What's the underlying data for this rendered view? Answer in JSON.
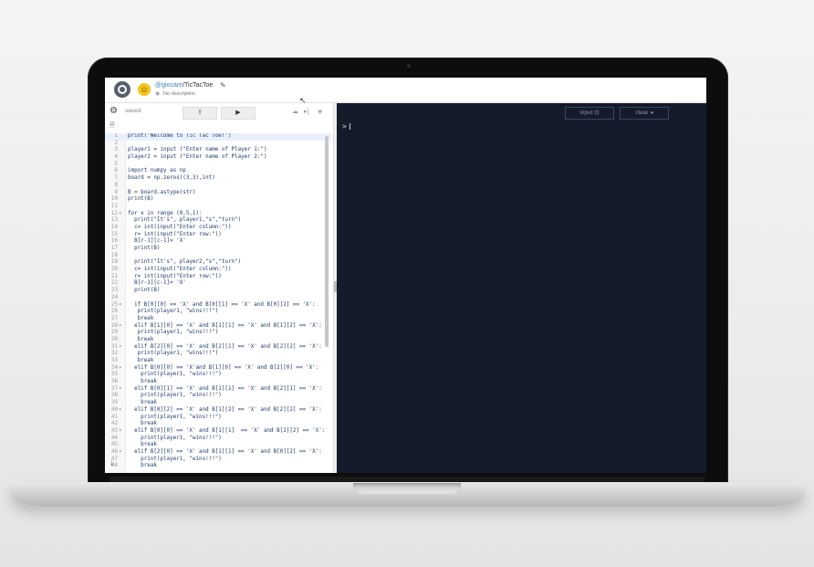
{
  "header": {
    "repo_user": "@giocare",
    "repo_sep": "/",
    "repo_name": "TicTacToe",
    "description": "No description"
  },
  "toolbar": {
    "saved_label": "saved",
    "share_icon": "share-icon",
    "run_icon": "play-icon"
  },
  "console": {
    "input_label": "input",
    "clear_label": "clear",
    "prompt": ">"
  },
  "editor": {
    "lines": [
      {
        "num": "1",
        "fold": "",
        "text": "print('Welcome to Tic Tac Toe!')"
      },
      {
        "num": "2",
        "fold": "",
        "text": ""
      },
      {
        "num": "3",
        "fold": "",
        "text": "player1 = input (\"Enter name of Player 1:\")"
      },
      {
        "num": "4",
        "fold": "",
        "text": "player2 = input (\"Enter name of Player 2:\")"
      },
      {
        "num": "5",
        "fold": "",
        "text": ""
      },
      {
        "num": "6",
        "fold": "",
        "text": "import numpy as np"
      },
      {
        "num": "7",
        "fold": "",
        "text": "board = np.zeros((3,3),int)"
      },
      {
        "num": "8",
        "fold": "",
        "text": ""
      },
      {
        "num": "9",
        "fold": "",
        "text": "B = board.astype(str)"
      },
      {
        "num": "10",
        "fold": "",
        "text": "print(B)"
      },
      {
        "num": "11",
        "fold": "",
        "text": ""
      },
      {
        "num": "12",
        "fold": "▾",
        "text": "for x in range (0,5,1):"
      },
      {
        "num": "13",
        "fold": "",
        "text": "  print(\"It's\", player1,\"s\",\"turn\")"
      },
      {
        "num": "14",
        "fold": "",
        "text": "  c= int(input(\"Enter column:\"))"
      },
      {
        "num": "15",
        "fold": "",
        "text": "  r= int(input(\"Enter row:\"))"
      },
      {
        "num": "16",
        "fold": "",
        "text": "  B[r-1][c-1]= 'X'"
      },
      {
        "num": "17",
        "fold": "",
        "text": "  print(B)"
      },
      {
        "num": "18",
        "fold": "",
        "text": ""
      },
      {
        "num": "19",
        "fold": "",
        "text": "  print(\"It's\", player2,\"s\",\"turn\")"
      },
      {
        "num": "20",
        "fold": "",
        "text": "  c= int(input(\"Enter column:\"))"
      },
      {
        "num": "21",
        "fold": "",
        "text": "  r= int(input(\"Enter row:\"))"
      },
      {
        "num": "22",
        "fold": "",
        "text": "  B[r-1][c-1]= 'O'"
      },
      {
        "num": "23",
        "fold": "",
        "text": "  print(B)"
      },
      {
        "num": "24",
        "fold": "",
        "text": ""
      },
      {
        "num": "25",
        "fold": "▾",
        "text": "  if B[0][0] == 'X' and B[0][1] == 'X' and B[0][2] == 'X':"
      },
      {
        "num": "26",
        "fold": "",
        "text": "   print(player1, \"wins!!!\")"
      },
      {
        "num": "27",
        "fold": "",
        "text": "   break"
      },
      {
        "num": "28",
        "fold": "▾",
        "text": "  elif B[1][0] == 'X' and B[1][1] == 'X' and B[1][2] == 'X':"
      },
      {
        "num": "29",
        "fold": "",
        "text": "   print(player1, \"wins!!!\")"
      },
      {
        "num": "30",
        "fold": "",
        "text": "   break"
      },
      {
        "num": "31",
        "fold": "▾",
        "text": "  elif B[2][0] == 'X' and B[2][1] == 'X' and B[2][2] == 'X':"
      },
      {
        "num": "32",
        "fold": "",
        "text": "   print(player1, \"wins!!!\")"
      },
      {
        "num": "33",
        "fold": "",
        "text": "   break"
      },
      {
        "num": "34",
        "fold": "▾",
        "text": "  elif B[0][0] == 'X'and B[1][0] == 'X' and B[2][0] == 'X':"
      },
      {
        "num": "35",
        "fold": "",
        "text": "    print(player1, \"wins!!!\")"
      },
      {
        "num": "36",
        "fold": "",
        "text": "    break"
      },
      {
        "num": "37",
        "fold": "▾",
        "text": "  elif B[0][1] == 'X' and B[1][1] == 'X' and B[2][1] == 'X':"
      },
      {
        "num": "38",
        "fold": "",
        "text": "    print(player1, \"wins!!!\")"
      },
      {
        "num": "39",
        "fold": "",
        "text": "    break"
      },
      {
        "num": "40",
        "fold": "▾",
        "text": "  elif B[0][2] == 'X' and B[1][2] == 'X' and B[2][2] == 'X':"
      },
      {
        "num": "41",
        "fold": "",
        "text": "    print(player1, \"wins!!!\")"
      },
      {
        "num": "42",
        "fold": "",
        "text": "    break"
      },
      {
        "num": "43",
        "fold": "▾",
        "text": "  elif B[0][0] == 'X' and B[1][1]  == 'X' and B[2][2] == 'X':"
      },
      {
        "num": "44",
        "fold": "",
        "text": "    print(player1, \"wins!!!\")"
      },
      {
        "num": "45",
        "fold": "",
        "text": "    break"
      },
      {
        "num": "46",
        "fold": "▾",
        "text": "  elif B[2][0] == 'X' and B[1][1] == 'X' and B[0][2] == 'X':"
      },
      {
        "num": "47",
        "fold": "",
        "text": "    print(player1, \"wins!!!\")"
      },
      {
        "num": "48",
        "fold": "",
        "text": "    break"
      }
    ]
  }
}
